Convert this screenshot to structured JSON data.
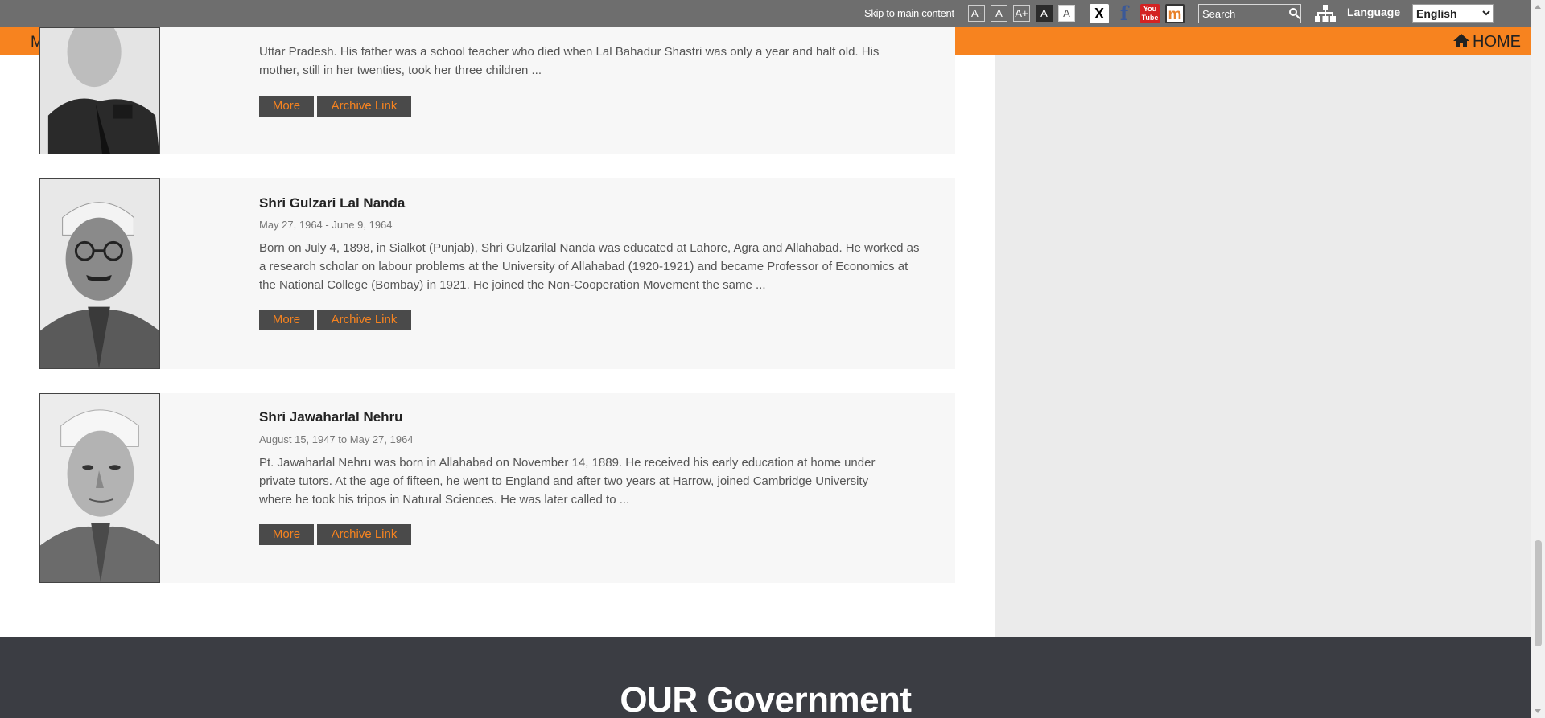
{
  "topbar": {
    "skip_link": "Skip to main content",
    "font_buttons": [
      "A-",
      "A",
      "A+",
      "A",
      "A"
    ],
    "social": [
      {
        "icon": "x-icon",
        "label": "X"
      },
      {
        "icon": "facebook-icon",
        "label": "f"
      },
      {
        "icon": "youtube-icon",
        "label": "You Tube"
      },
      {
        "icon": "mygov-icon",
        "label": "m"
      }
    ],
    "search_placeholder": "Search",
    "language_label": "Language",
    "language_selected": "English"
  },
  "nav": {
    "menu_label": "MENU",
    "home_label": "HOME",
    "accent_color": "#f7831f"
  },
  "cards": [
    {
      "name": "",
      "dates": "",
      "bio_visible": [
        "Uttar Pradesh. His father was a school teacher who died when Lal Bahadur Shastri was only a year and half old. His",
        "mother, still in her twenties, took her three children ..."
      ],
      "more_label": "More",
      "archive_label": "Archive Link"
    },
    {
      "name": "Shri Gulzari Lal Nanda",
      "dates": "May 27, 1964 - June 9, 1964",
      "bio_visible": [
        "Born on July 4, 1898, in Sialkot (Punjab), Shri Gulzarilal Nanda was educated at Lahore, Agra and Allahabad. He worked as",
        "a research scholar on labour problems at the University of Allahabad (1920-1921) and became Professor of Economics at",
        "the National College (Bombay) in 1921. He joined the Non-Cooperation Movement the same ..."
      ],
      "more_label": "More",
      "archive_label": "Archive Link"
    },
    {
      "name": "Shri Jawaharlal Nehru",
      "dates": "August 15, 1947 to May 27, 1964",
      "bio_visible": [
        "Pt. Jawaharlal Nehru was born in Allahabad on November 14, 1889. He received his early education at home under",
        "private tutors. At the age of fifteen, he went to England and after two years at Harrow, joined Cambridge University",
        "where he took his tripos in Natural Sciences. He was later called to ..."
      ],
      "more_label": "More",
      "archive_label": "Archive Link"
    }
  ],
  "footer": {
    "title": "OUR Government"
  }
}
